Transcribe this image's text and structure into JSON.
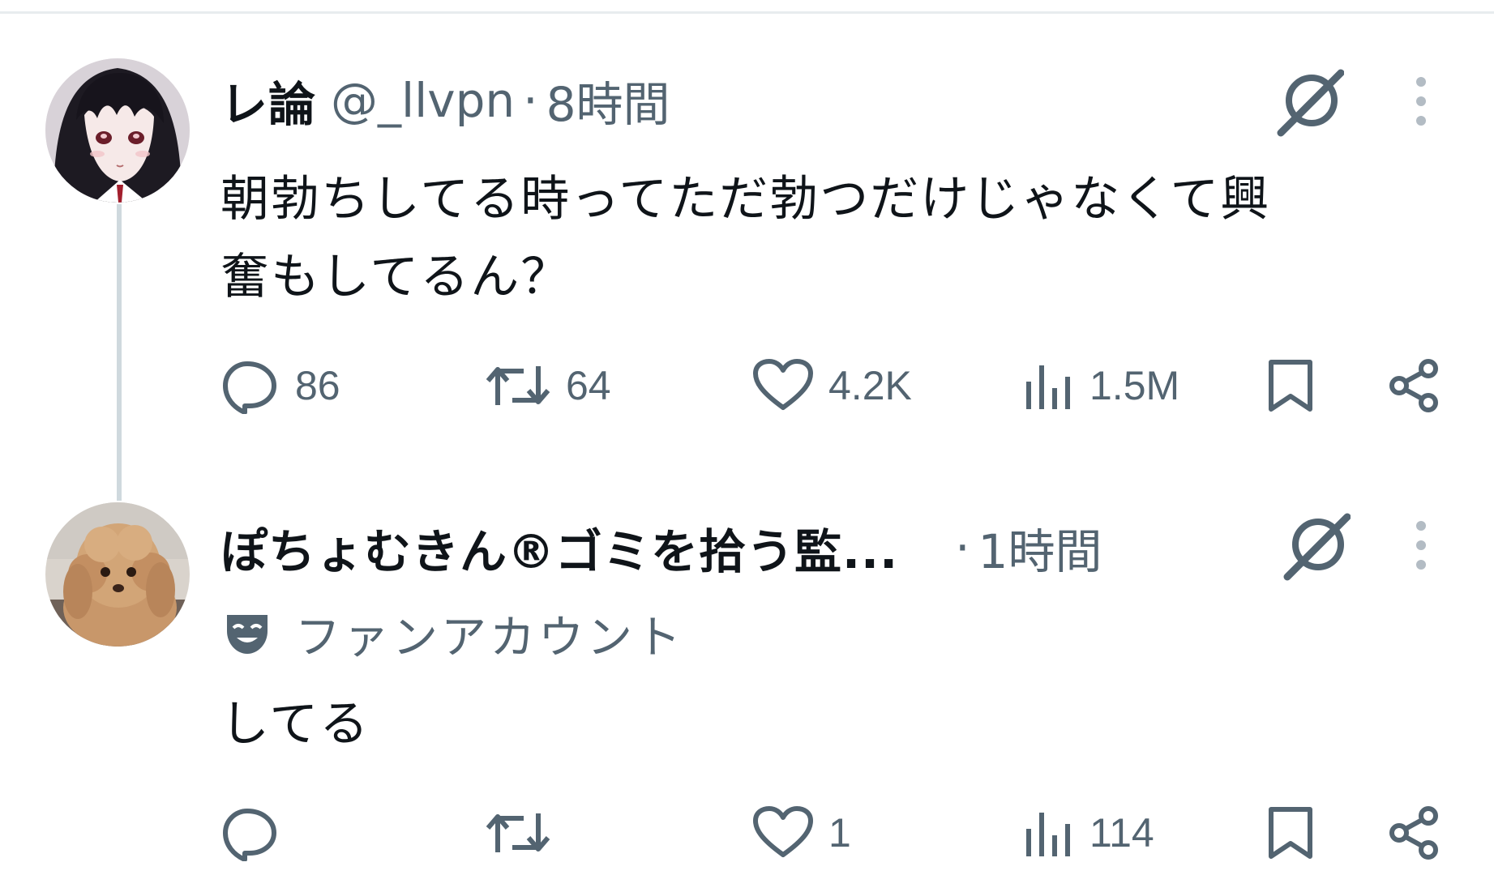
{
  "tweets": [
    {
      "display_name": "レ論",
      "handle": "@_llvpn",
      "separator": "·",
      "time": "8時間",
      "text_lines": [
        "朝勃ちしてる時ってただ勃つだけじゃなくて興",
        "奮もしてるん？"
      ],
      "actions": {
        "reply_count": "86",
        "repost_count": "64",
        "like_count": "4.2K",
        "views_count": "1.5M"
      },
      "avatar_icon": "anime-girl-avatar"
    },
    {
      "display_name": "ぽちょむきん®ゴミを拾う監...",
      "separator": "·",
      "time": "1時間",
      "badge_label": "ファンアカウント",
      "badge_icon": "mask-icon",
      "text_lines": [
        "してる"
      ],
      "actions": {
        "reply_count": "",
        "repost_count": "",
        "like_count": "1",
        "views_count": "114"
      },
      "avatar_icon": "poodle-dog-avatar"
    }
  ],
  "colors": {
    "primary_text": "#0f1419",
    "secondary_text": "#536471",
    "divider": "#e8ecee",
    "thread_line": "#cfd9de",
    "background": "#ffffff"
  }
}
